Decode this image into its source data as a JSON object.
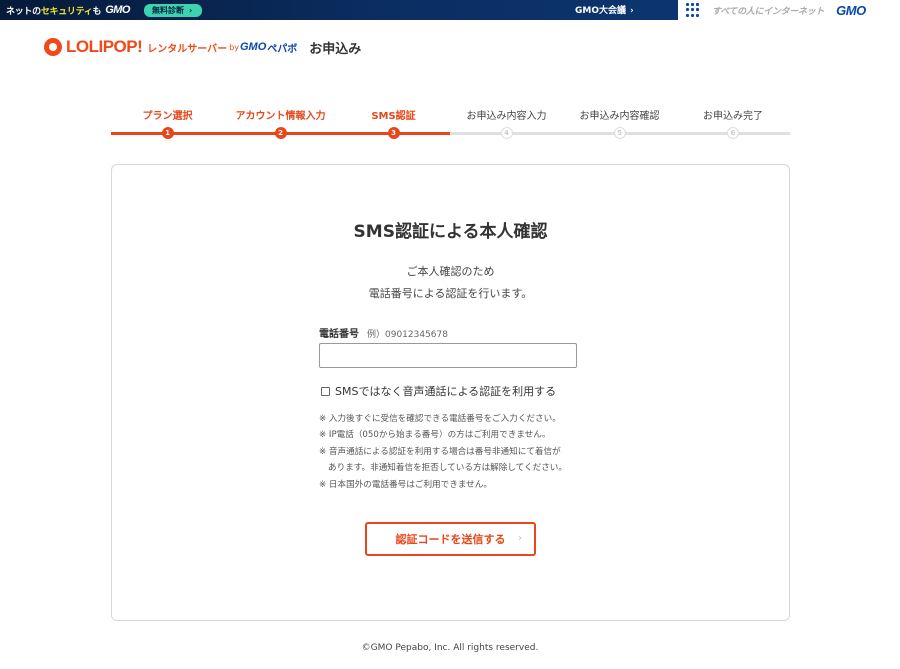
{
  "gmo_bar": {
    "security_pre": "ネットの",
    "security_hl": "セキュリティ",
    "security_post": "も",
    "gmo_logo": "GMO",
    "diagnosis_label": "無料診断",
    "chevron": "›",
    "meeting_label": "GMO大会議",
    "internet_text": "すべての人にインターネット",
    "gmo_logo_right": "GMO",
    "accent": "#0b2e63",
    "diag_color": "#3ed3b0"
  },
  "header": {
    "brand": "LOLIPOP!",
    "brand_sub": "レンタルサーバー",
    "by": "by",
    "gmo": "GMO",
    "pepabo": "ペパボ",
    "page_title": "お申込み",
    "brand_color": "#f04a1a"
  },
  "stepper": {
    "steps": [
      {
        "label": "プラン選択",
        "number": "1",
        "status": "done"
      },
      {
        "label": "アカウント情報入力",
        "number": "2",
        "status": "done"
      },
      {
        "label": "SMS認証",
        "number": "3",
        "status": "current"
      },
      {
        "label": "お申込み内容入力",
        "number": "4",
        "status": "todo"
      },
      {
        "label": "お申込み内容確認",
        "number": "5",
        "status": "todo"
      },
      {
        "label": "お申込み完了",
        "number": "6",
        "status": "todo"
      }
    ],
    "active_color": "#e8471b"
  },
  "card": {
    "title": "SMS認証による本人確認",
    "desc_line1": "ご本人確認のため",
    "desc_line2": "電話番号による認証を行います。",
    "phone_label": "電話番号",
    "phone_hint": "例）09012345678",
    "phone_value": "",
    "voice_option_label": "SMSではなく音声通話による認証を利用する",
    "voice_checked": false,
    "notes": {
      "n1": "※ 入力後すぐに受信を確認できる電話番号をご入力ください。",
      "n2": "※ IP電話（050から始まる番号）の方はご利用できません。",
      "n3a": "※ 音声通話による認証を利用する場合は番号非通知にて着信が",
      "n3b": "あります。非通知着信を拒否している方は解除してください。",
      "n4": "※ 日本国外の電話番号はご利用できません。"
    },
    "send_button_label": "認証コードを送信する",
    "send_chevron": "›"
  },
  "footer": {
    "copyright": "©GMO Pepabo, Inc. All rights reserved."
  }
}
